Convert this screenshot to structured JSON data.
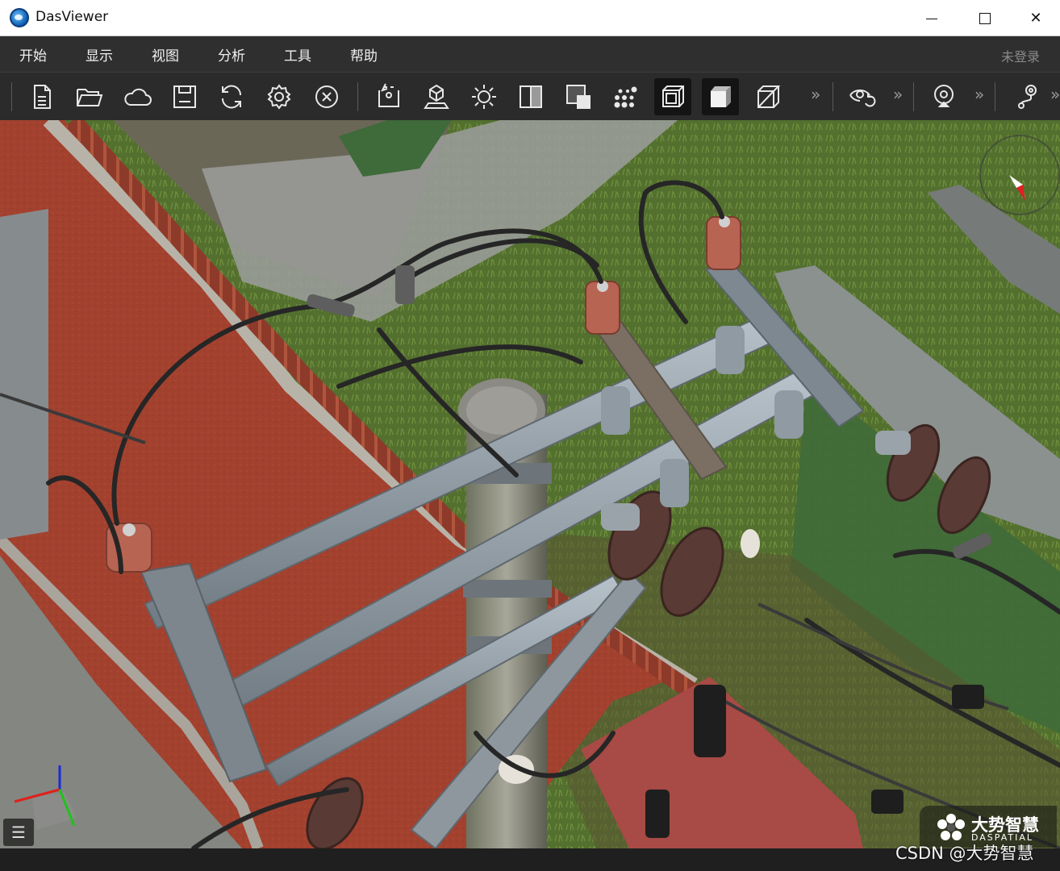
{
  "window": {
    "title": "DasViewer",
    "minimize_icon": "minimize-icon",
    "maximize_icon": "maximize-icon",
    "close_label": "✕"
  },
  "menu": {
    "items": [
      "开始",
      "显示",
      "视图",
      "分析",
      "工具",
      "帮助"
    ],
    "login_status": "未登录"
  },
  "toolbar": {
    "buttons": [
      {
        "icon": "new-file-icon"
      },
      {
        "icon": "open-folder-icon"
      },
      {
        "icon": "cloud-icon"
      },
      {
        "icon": "save-icon"
      },
      {
        "icon": "refresh-icon"
      },
      {
        "icon": "settings-icon"
      },
      {
        "icon": "close-circle-icon"
      },
      {
        "icon": "locate-icon"
      },
      {
        "icon": "terrain-model-icon"
      },
      {
        "icon": "light-icon"
      },
      {
        "icon": "split-view-icon"
      },
      {
        "icon": "edl-icon"
      },
      {
        "icon": "point-cloud-icon"
      },
      {
        "icon": "wireframe-cube-icon",
        "active": true
      },
      {
        "icon": "solid-cube-icon",
        "active": true
      },
      {
        "icon": "outline-cube-icon"
      },
      {
        "icon": "eye-rotate-icon"
      },
      {
        "icon": "location-pin-icon"
      },
      {
        "icon": "route-icon"
      }
    ],
    "more_label": "»"
  },
  "viewport": {
    "compass_icon": "compass-icon",
    "axis_icon": "axis-gizmo-icon",
    "panel_toggle_label": "☰"
  },
  "brand": {
    "name_cn": "大势智慧",
    "name_en": "DASPATIAL"
  },
  "watermark": "CSDN @大势智慧",
  "colors": {
    "menubar": "#2f2f2f",
    "toolbar": "#2b2b2b",
    "track": "#a8412f",
    "grass": "#4f6b34",
    "steel": "#8e9aa3"
  }
}
